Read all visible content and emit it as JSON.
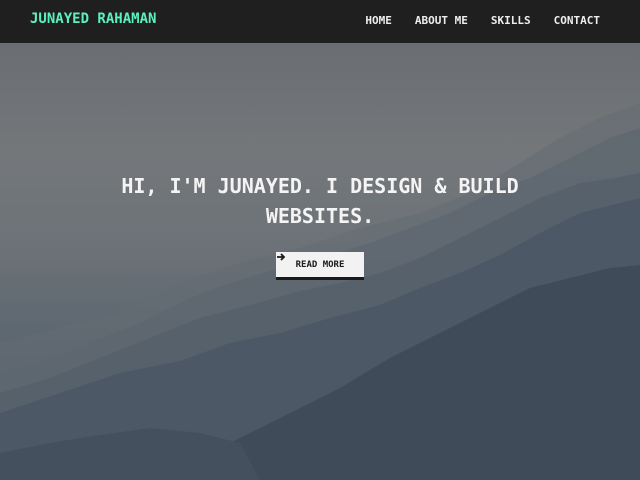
{
  "nav": {
    "brand": "JUNAYED RAHAMAN",
    "links": [
      {
        "label": "HOME"
      },
      {
        "label": "ABOUT ME"
      },
      {
        "label": "SKILLS"
      },
      {
        "label": "CONTACT"
      }
    ]
  },
  "hero": {
    "headline": "HI, I'M JUNAYED. I DESIGN & BUILD WEBSITES.",
    "cta_label": "READ MORE",
    "cta_icon": "arrow-right-icon",
    "background": "misty-mountains"
  },
  "colors": {
    "nav_bg": "#1f1f1f",
    "brand": "#5cf0c0",
    "nav_link": "#eeeeee",
    "headline": "#f4f4f4",
    "cta_bg": "#f2f2f2",
    "cta_text": "#1a1a1a"
  }
}
